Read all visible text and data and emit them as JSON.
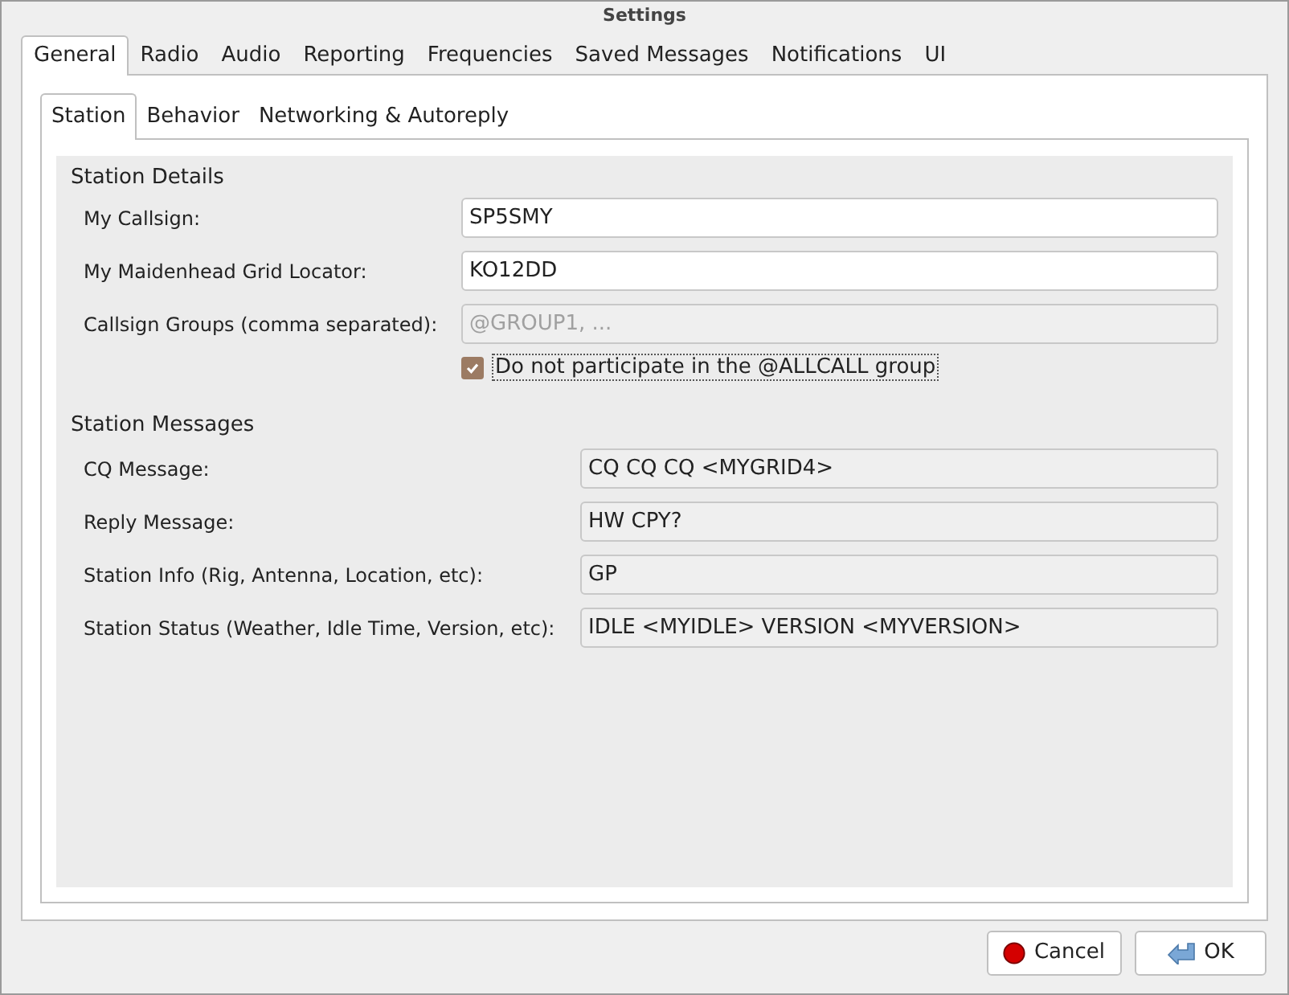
{
  "window": {
    "title": "Settings"
  },
  "tabs": [
    {
      "label": "General",
      "selected": true
    },
    {
      "label": "Radio",
      "selected": false
    },
    {
      "label": "Audio",
      "selected": false
    },
    {
      "label": "Reporting",
      "selected": false
    },
    {
      "label": "Frequencies",
      "selected": false
    },
    {
      "label": "Saved Messages",
      "selected": false
    },
    {
      "label": "Notifications",
      "selected": false
    },
    {
      "label": "UI",
      "selected": false
    }
  ],
  "subtabs": [
    {
      "label": "Station",
      "selected": true
    },
    {
      "label": "Behavior",
      "selected": false
    },
    {
      "label": "Networking & Autoreply",
      "selected": false
    }
  ],
  "station_details": {
    "title": "Station Details",
    "fields": [
      {
        "label": "My Callsign:",
        "value": "SP5SMY",
        "read_only": false
      },
      {
        "label": "My Maidenhead Grid Locator:",
        "value": "KO12DD",
        "read_only": false
      },
      {
        "label": "Callsign Groups (comma separated):",
        "placeholder": "@GROUP1, ...",
        "read_only": true
      }
    ],
    "checkbox": {
      "label": "Do not participate in the @ALLCALL group",
      "checked": true
    }
  },
  "station_messages": {
    "title": "Station Messages",
    "fields": [
      {
        "label": "CQ Message:",
        "value": "CQ CQ CQ <MYGRID4>",
        "read_only": true
      },
      {
        "label": "Reply Message:",
        "value": "HW CPY?",
        "read_only": true
      },
      {
        "label": "Station Info (Rig, Antenna, Location, etc):",
        "value": "GP",
        "read_only": true
      },
      {
        "label": "Station Status (Weather, Idle Time, Version, etc):",
        "value": "IDLE <MYIDLE> VERSION <MYVERSION>",
        "read_only": true
      }
    ]
  },
  "buttons": [
    {
      "label": "Cancel",
      "kind": "cancel"
    },
    {
      "label": "OK",
      "kind": "ok"
    }
  ]
}
